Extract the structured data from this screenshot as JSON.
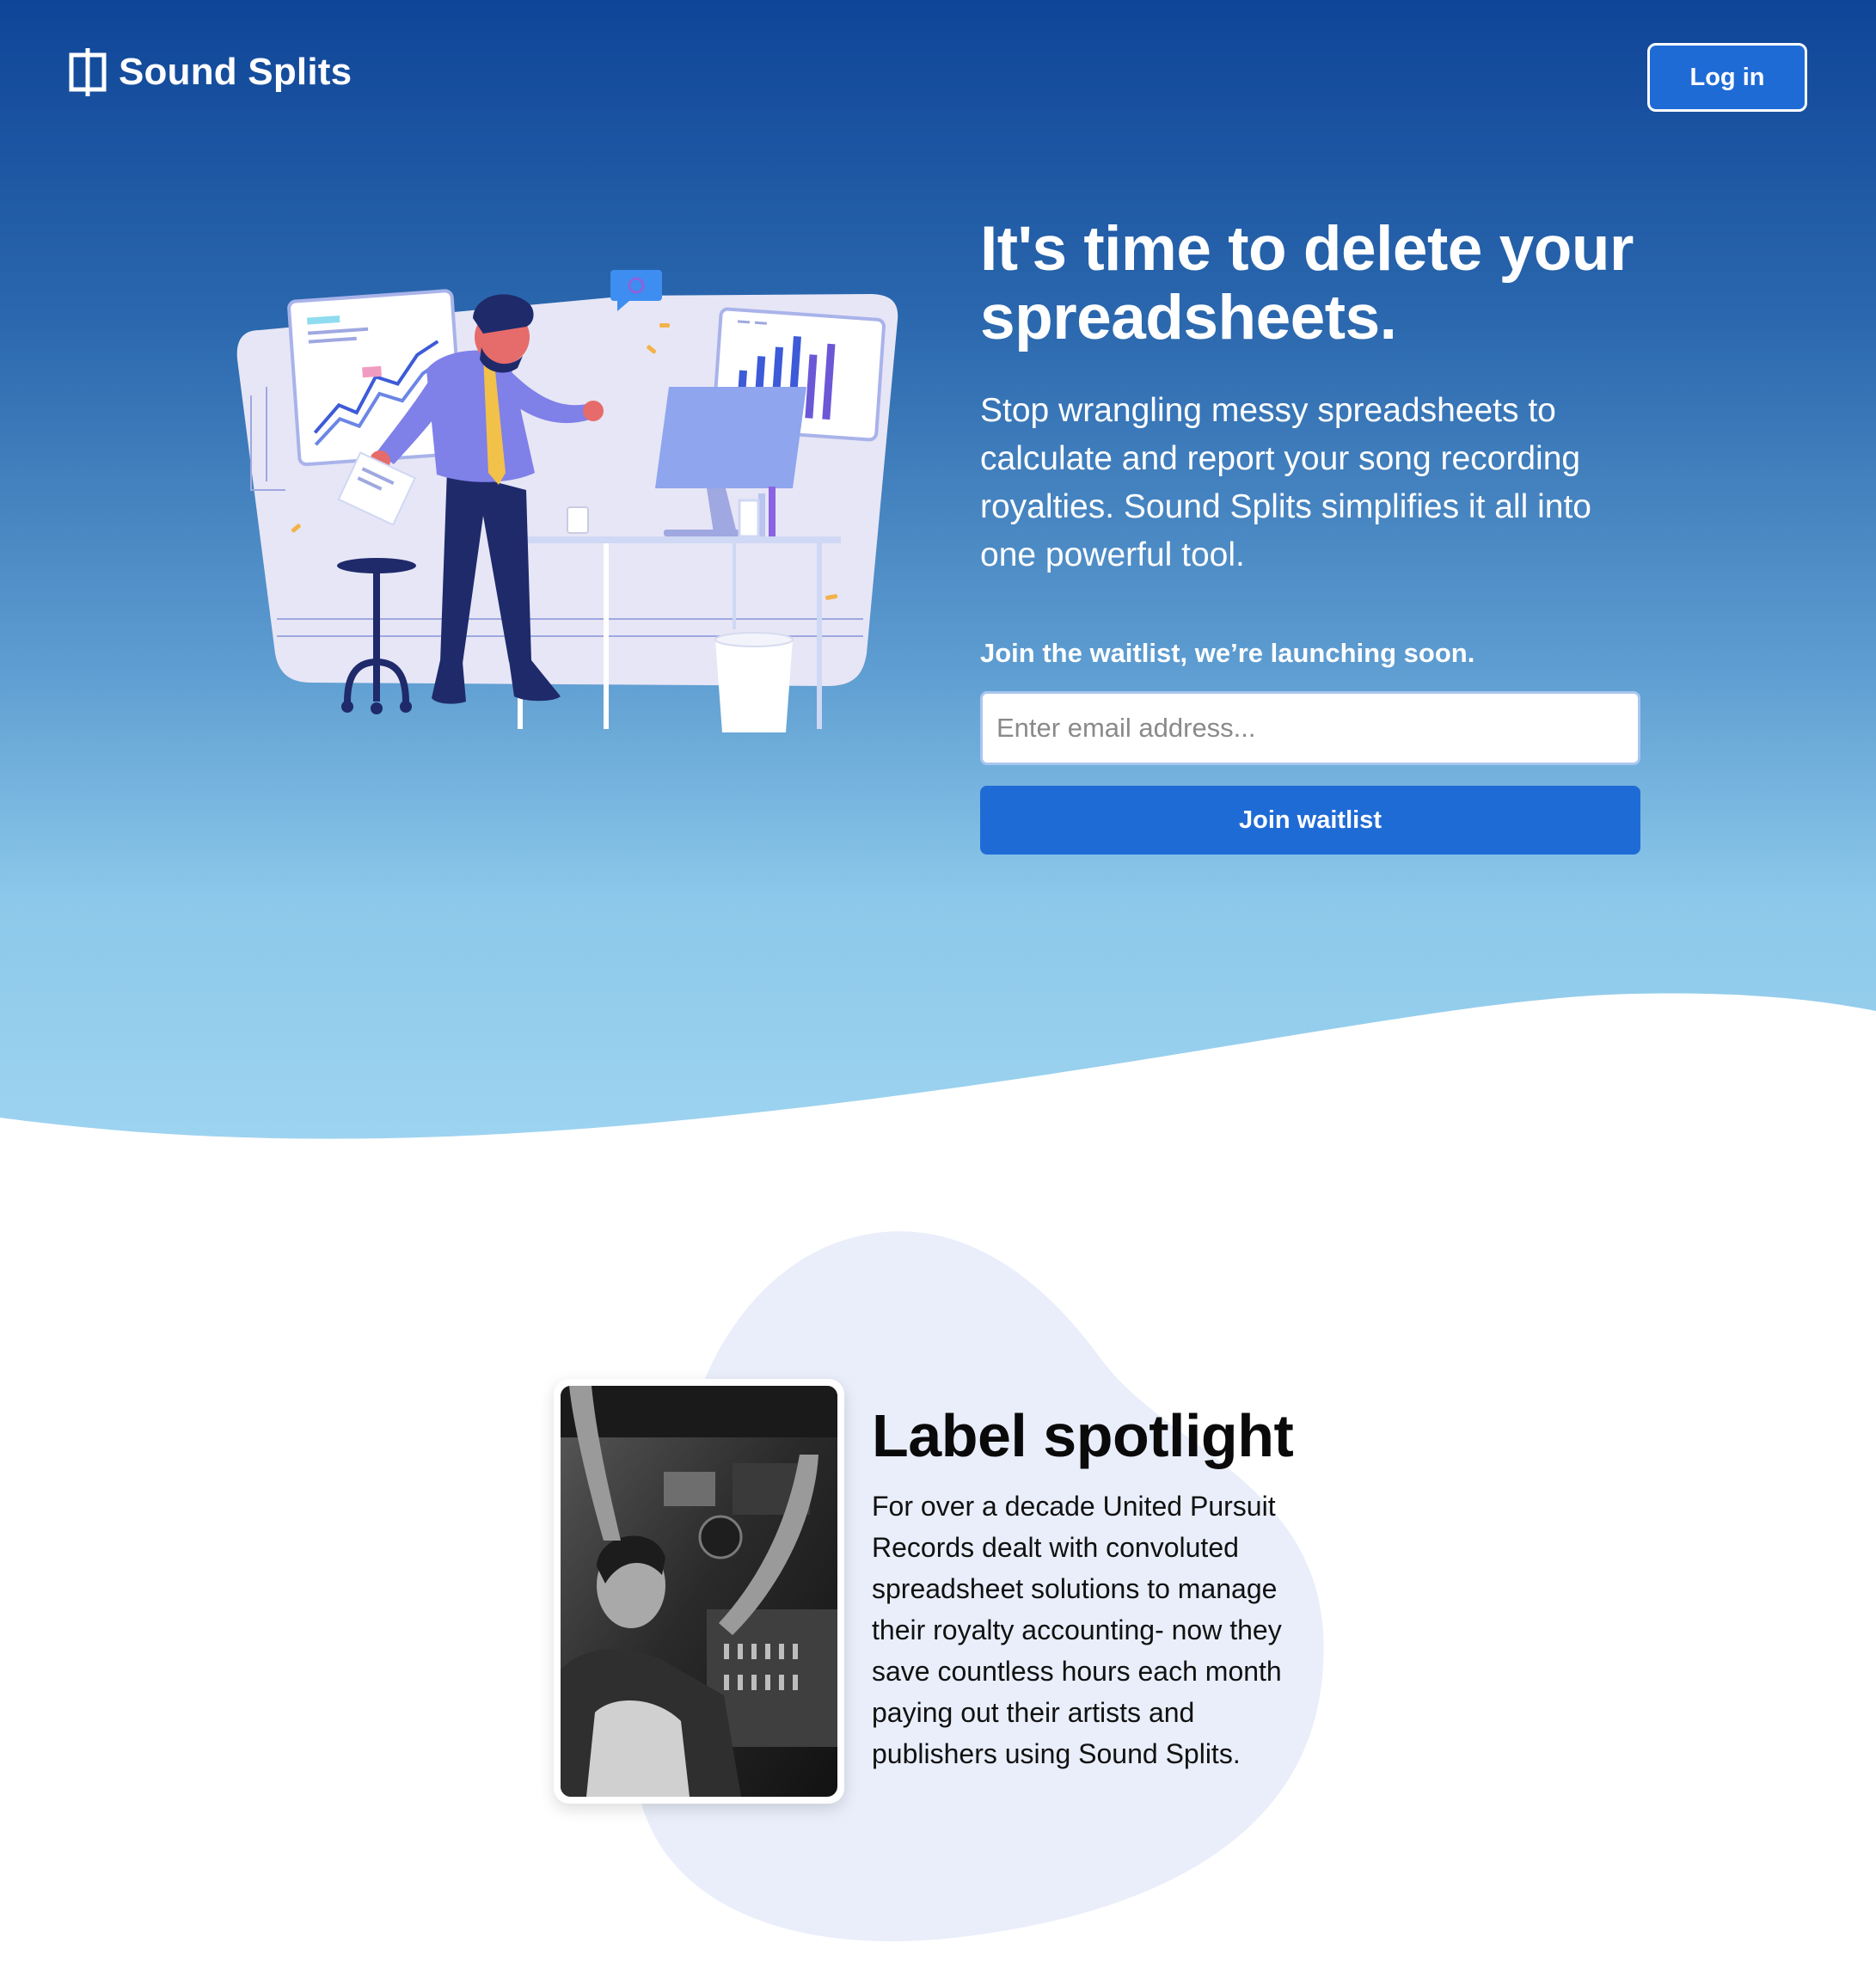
{
  "brand": {
    "name": "Sound Splits",
    "logo_icon": "column-split-icon"
  },
  "nav": {
    "login_label": "Log in"
  },
  "hero": {
    "title": "It's time to delete your spreadsheets.",
    "subtitle": "Stop wrangling messy spreadsheets to calculate and report your song recording royalties. Sound Splits simplifies it all into one powerful tool.",
    "illustration": "analyst-at-desk-illustration"
  },
  "waitlist": {
    "label": "Join the waitlist, we’re launching soon.",
    "email_placeholder": "Enter email address...",
    "email_value": "",
    "button_label": "Join waitlist"
  },
  "spotlight": {
    "title": "Label spotlight",
    "body": "For over a decade United Pursuit Records dealt with convoluted spreadsheet solutions to manage their royalty accounting- now they save countless hours each month paying out their artists and publishers using Sound Splits.",
    "photo": "studio-artist-photo"
  },
  "colors": {
    "hero_top": "#0f4598",
    "hero_bottom": "#9ed4f0",
    "accent": "#1f6bd6",
    "blob": "#e9eefa"
  }
}
